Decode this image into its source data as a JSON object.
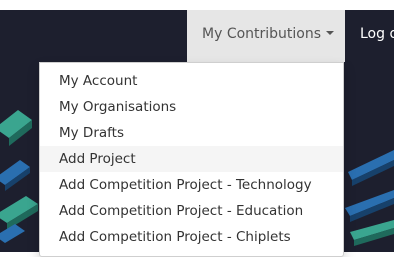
{
  "navbar": {
    "contributions_label": "My Contributions",
    "logout_label": "Log out"
  },
  "dropdown": {
    "items": [
      {
        "label": "My Account"
      },
      {
        "label": "My Organisations"
      },
      {
        "label": "My Drafts"
      },
      {
        "label": "Add Project",
        "highlighted": true
      },
      {
        "label": "Add Competition Project - Technology"
      },
      {
        "label": "Add Competition Project - Education"
      },
      {
        "label": "Add Competition Project - Chiplets"
      }
    ]
  },
  "colors": {
    "navbar_bg": "#1d1f2e",
    "active_tab_bg": "#e6e6e6",
    "menu_hover_bg": "#f5f5f5",
    "menu_text": "#333333",
    "art_teal": "#3aa58f",
    "art_blue": "#2a6fb0"
  }
}
